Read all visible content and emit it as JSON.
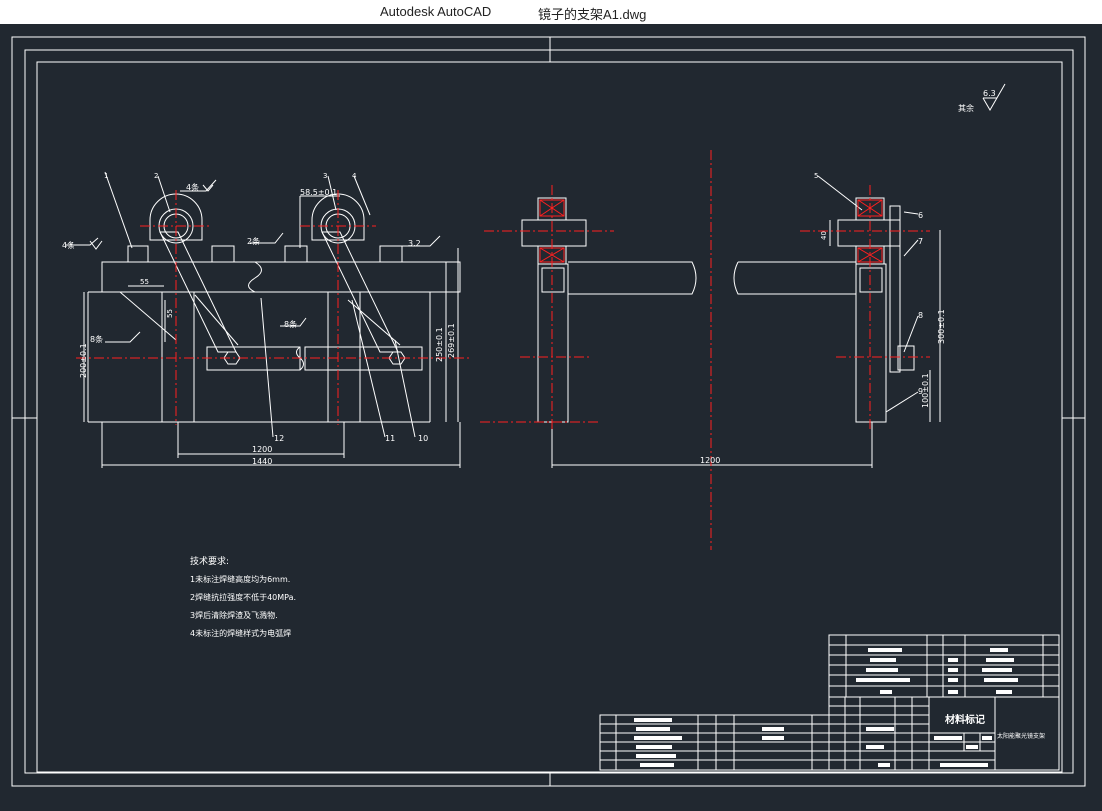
{
  "window": {
    "app_name": "Autodesk AutoCAD",
    "file_name": "镜子的支架A1.dwg"
  },
  "drawing": {
    "roughness": {
      "value": "6.3",
      "remainder": "其余"
    },
    "dims": {
      "w1200_front": "1200",
      "w1440": "1440",
      "w1200_side": "1200",
      "h200": "200±0.1",
      "h250": "250±0.1",
      "h269": "269±0.1",
      "h300": "300±0.1",
      "h100": "100±0.1",
      "d55a": "55",
      "d55b": "55",
      "d58": "58.5±0.1",
      "d32": "3.2",
      "d40": "40"
    },
    "welds": {
      "w4a": "4条",
      "w4b": "4条",
      "w2": "2条",
      "w8a": "8条",
      "w8b": "8条"
    },
    "balloons": [
      "1",
      "2",
      "3",
      "4",
      "5",
      "6",
      "7",
      "8",
      "9",
      "10",
      "11",
      "12"
    ],
    "notes": {
      "title": "技术要求:",
      "items": [
        "1未标注焊缝高度均为6mm.",
        "2焊缝抗拉强度不低于40MPa.",
        "3焊后清除焊渣及飞溅物.",
        "4未标注的焊缝样式为电弧焊"
      ]
    },
    "title_block": {
      "material_label": "材料标记",
      "drawing_name": "太阳能聚光镜支架"
    }
  },
  "colors": {
    "background": "#212830",
    "line": "#ffffff",
    "center_line": "#ff2020",
    "titlebar": "#ffffff"
  }
}
